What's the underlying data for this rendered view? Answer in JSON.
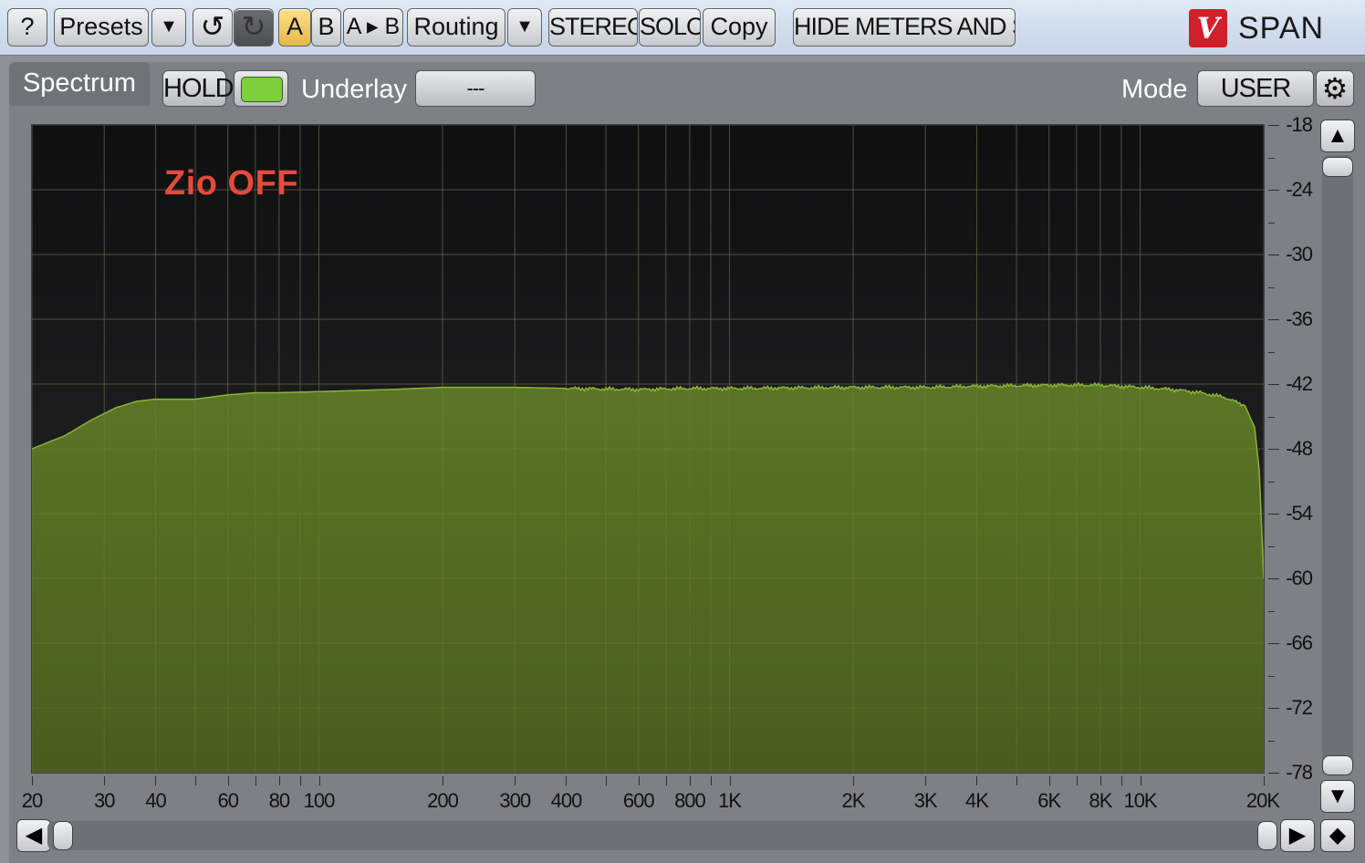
{
  "app": {
    "logo_glyph": "V",
    "brand": "SPAN"
  },
  "toolbar": {
    "help": "?",
    "presets": "Presets",
    "presets_menu": "▼",
    "undo": "↺",
    "redo": "↻",
    "a": "A",
    "b": "B",
    "a_to_b": "A ▸ B",
    "routing": "Routing",
    "routing_menu": "▼",
    "stereo": "STEREO",
    "solo": "SOLO",
    "copy": "Copy",
    "hide_meters": "HIDE METERS AND STATS"
  },
  "panel": {
    "tab": "Spectrum",
    "hold": "HOLD",
    "underlay_label": "Underlay",
    "underlay_value": "---",
    "mode_label": "Mode",
    "mode_value": "USER",
    "overlay_note": "Zio OFF",
    "accent_color": "#7ccf3a",
    "note_color": "#e64a3d"
  },
  "chart_data": {
    "type": "area",
    "xscale": "log",
    "xlim": [
      20,
      20000
    ],
    "ylim": [
      -78,
      -18
    ],
    "x_ticks": [
      "20",
      "30",
      "40",
      "60",
      "80",
      "100",
      "200",
      "300",
      "400",
      "600",
      "800",
      "1K",
      "2K",
      "3K",
      "4K",
      "6K",
      "8K",
      "10K",
      "20K"
    ],
    "y_ticks": [
      "-18",
      "-24",
      "-30",
      "-36",
      "-42",
      "-48",
      "-54",
      "-60",
      "-66",
      "-72",
      "-78"
    ],
    "x": [
      20,
      24,
      28,
      32,
      36,
      40,
      50,
      60,
      70,
      80,
      100,
      150,
      200,
      300,
      400,
      600,
      800,
      1000,
      2000,
      3000,
      4000,
      6000,
      8000,
      10000,
      12000,
      14000,
      16000,
      18000,
      19000,
      19500,
      19800,
      20000
    ],
    "values": [
      -48.0,
      -46.8,
      -45.3,
      -44.2,
      -43.6,
      -43.4,
      -43.4,
      -43.0,
      -42.8,
      -42.8,
      -42.7,
      -42.5,
      -42.3,
      -42.3,
      -42.4,
      -42.5,
      -42.4,
      -42.4,
      -42.3,
      -42.3,
      -42.2,
      -42.1,
      -42.1,
      -42.3,
      -42.5,
      -42.8,
      -43.2,
      -44.0,
      -46.0,
      -50.0,
      -56.0,
      -60.0
    ],
    "fill_color": "#556b22"
  }
}
